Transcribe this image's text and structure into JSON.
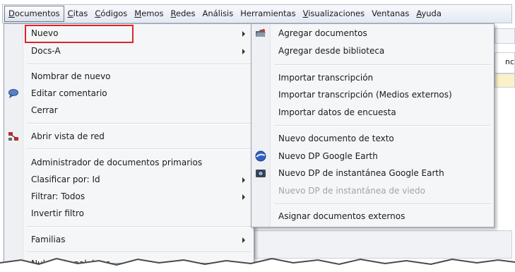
{
  "menubar": {
    "items": [
      {
        "label": "Documentos",
        "ul": "D",
        "rest": "ocumentos"
      },
      {
        "label": "Citas",
        "ul": "C",
        "rest": "itas"
      },
      {
        "label": "Códigos",
        "ul": "C",
        "rest": "ódigos"
      },
      {
        "label": "Memos",
        "ul": "M",
        "rest": "emos"
      },
      {
        "label": "Redes",
        "ul": "R",
        "rest": "edes"
      },
      {
        "label": "Análisis",
        "ul": "A",
        "rest": "nálisis"
      },
      {
        "label": "Herramientas",
        "ul": "H",
        "rest": "erramientas"
      },
      {
        "label": "Visualizaciones",
        "ul": "V",
        "rest": "isualizaciones"
      },
      {
        "label": "Ventanas",
        "ul": "V",
        "rest": "entanas"
      },
      {
        "label": "Ayuda",
        "ul": "A",
        "rest": "yuda"
      }
    ]
  },
  "documentos_menu": {
    "items": [
      {
        "label": "Nuevo"
      },
      {
        "label": "Docs-A"
      },
      {
        "label": "Nombrar de nuevo"
      },
      {
        "label": "Editar comentario"
      },
      {
        "label": "Cerrar"
      },
      {
        "label": "Abrir vista de red"
      },
      {
        "label": "Administrador de documentos primarios"
      },
      {
        "label": "Clasificar por: Id"
      },
      {
        "label": "Filtrar: Todos"
      },
      {
        "label": "Invertir filtro"
      },
      {
        "label": "Familias"
      },
      {
        "label": "Nubes de palabras"
      }
    ]
  },
  "nuevo_submenu": {
    "items": [
      {
        "label": "Agregar documentos"
      },
      {
        "label": "Agregar desde biblioteca"
      },
      {
        "label": "Importar transcripción"
      },
      {
        "label": "Importar transcripción (Medios externos)"
      },
      {
        "label": "Importar datos de encuesta"
      },
      {
        "label": "Nuevo documento de texto"
      },
      {
        "label": "Nuevo DP Google Earth"
      },
      {
        "label": "Nuevo DP de instantánea Google Earth"
      },
      {
        "label": "Nuevo DP de instantánea de viedo"
      },
      {
        "label": "Asignar documentos externos"
      }
    ]
  },
  "background": {
    "right_fragment": "nc"
  },
  "colors": {
    "highlight_box": "#d9262c",
    "menu_bg": "#f5f6f7"
  }
}
